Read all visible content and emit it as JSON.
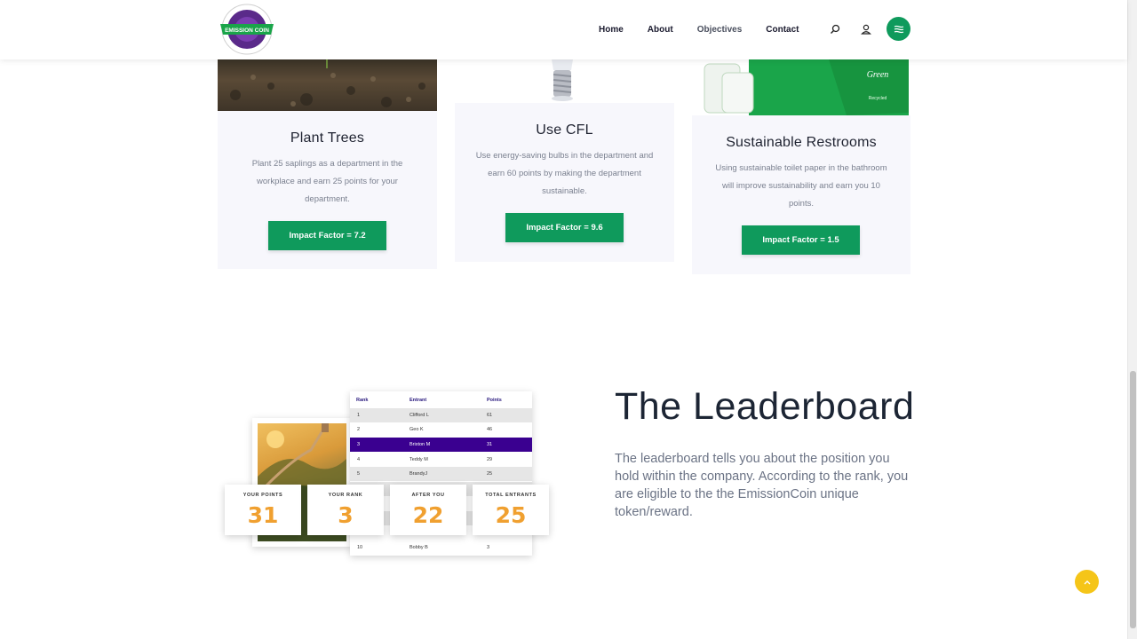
{
  "logo": {
    "text": "EMISSION COIN"
  },
  "nav": {
    "home": "Home",
    "about": "About",
    "objectives": "Objectives",
    "contact": "Contact"
  },
  "cards": [
    {
      "title": "Plant Trees",
      "text": "Plant 25 saplings as a department in the workplace and earn 25 points for your department.",
      "button": "Impact Factor = 7.2"
    },
    {
      "title": "Use CFL",
      "text": "Use energy-saving bulbs in the department and earn 60 points by making the department sustainable.",
      "button": "Impact Factor = 9.6"
    },
    {
      "title": "Sustainable Restrooms",
      "text": "Using sustainable toilet paper in the bathroom will improve sustainability and earn you 10 points.",
      "button": "Impact Factor = 1.5"
    }
  ],
  "restroom_image": {
    "brand": "Green",
    "label": "Recycled"
  },
  "leaderboard": {
    "title": "The Leaderboard",
    "text": "The leaderboard tells you about the position you hold within the company. According to the rank, you are eligible to the the EmissionCoin unique token/reward.",
    "table": {
      "headers": [
        "Rank",
        "Entrant",
        "Points"
      ],
      "rows": [
        [
          "1",
          "Clifford L",
          "61"
        ],
        [
          "2",
          "Geo K",
          "46"
        ],
        [
          "3",
          "Brixton M",
          "31"
        ],
        [
          "4",
          "Teddy M",
          "29"
        ],
        [
          "5",
          "BrandyJ",
          "25"
        ],
        [
          "10",
          "Bobby B",
          "3"
        ]
      ]
    },
    "stats": [
      {
        "label": "YOUR POINTS",
        "value": "31"
      },
      {
        "label": "YOUR RANK",
        "value": "3"
      },
      {
        "label": "AFTER YOU",
        "value": "22"
      },
      {
        "label": "TOTAL ENTRANTS",
        "value": "25"
      }
    ]
  },
  "colors": {
    "accent": "#0f9a5c",
    "stat": "#f0a030",
    "highlight_row": "#3a0090",
    "to_top": "#f5c518"
  }
}
